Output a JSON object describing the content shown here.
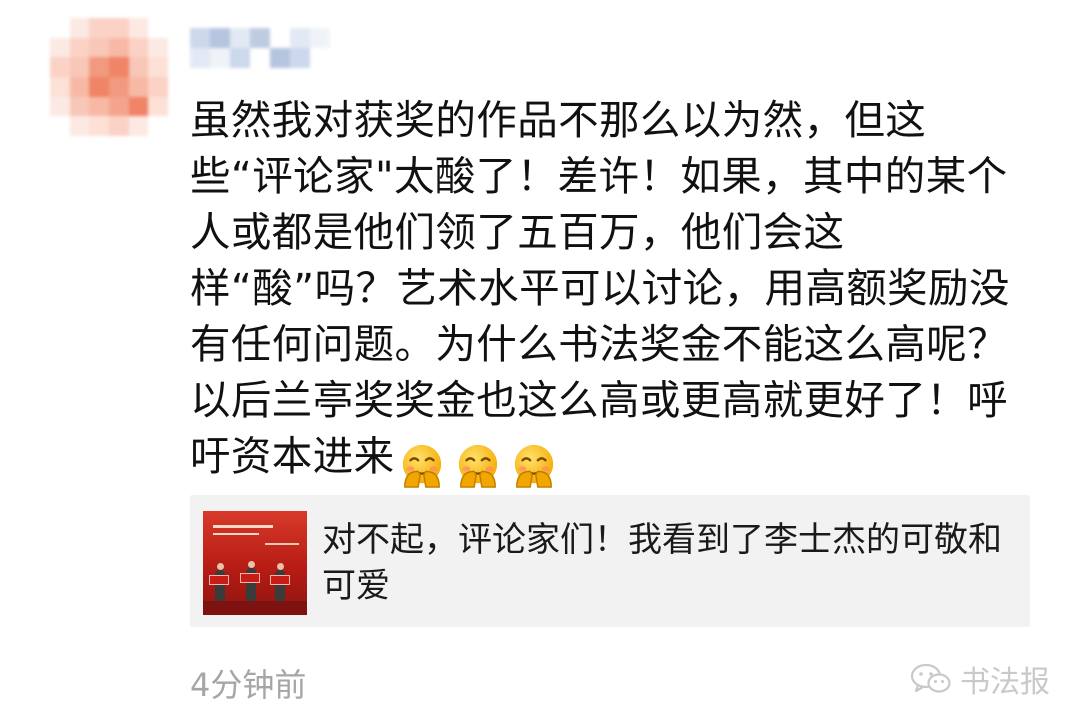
{
  "moment": {
    "author": {
      "avatar_icon": "blurred-avatar-icon",
      "name_hidden": true
    },
    "text": "虽然我对获奖的作品不那么以为然，但这些“评论家\"太酸了！差许！如果，其中的某个人或都是他们领了五百万，他们会这样“酸”吗？艺术水平可以讨论，用高额奖励没有任何问题。为什么书法奖金不能这么高呢？以后兰亭奖奖金也这么高或更高就更好了！呼吁资本进来",
    "emojis": [
      "blush-face-icon",
      "blush-face-icon",
      "blush-face-icon"
    ],
    "shared_article": {
      "title": "对不起，评论家们！我看到了李士杰的可敬和可爱",
      "thumbnail_icon": "article-thumbnail-image"
    },
    "timestamp": "4分钟前"
  },
  "watermark": {
    "label": "书法报",
    "icon": "wechat-icon"
  },
  "colors": {
    "text": "#111111",
    "timestamp": "#a6a6a6",
    "card_bg": "#f2f2f2",
    "thumb_red": "#c8231e",
    "emoji_yellow": "#f7b500"
  }
}
